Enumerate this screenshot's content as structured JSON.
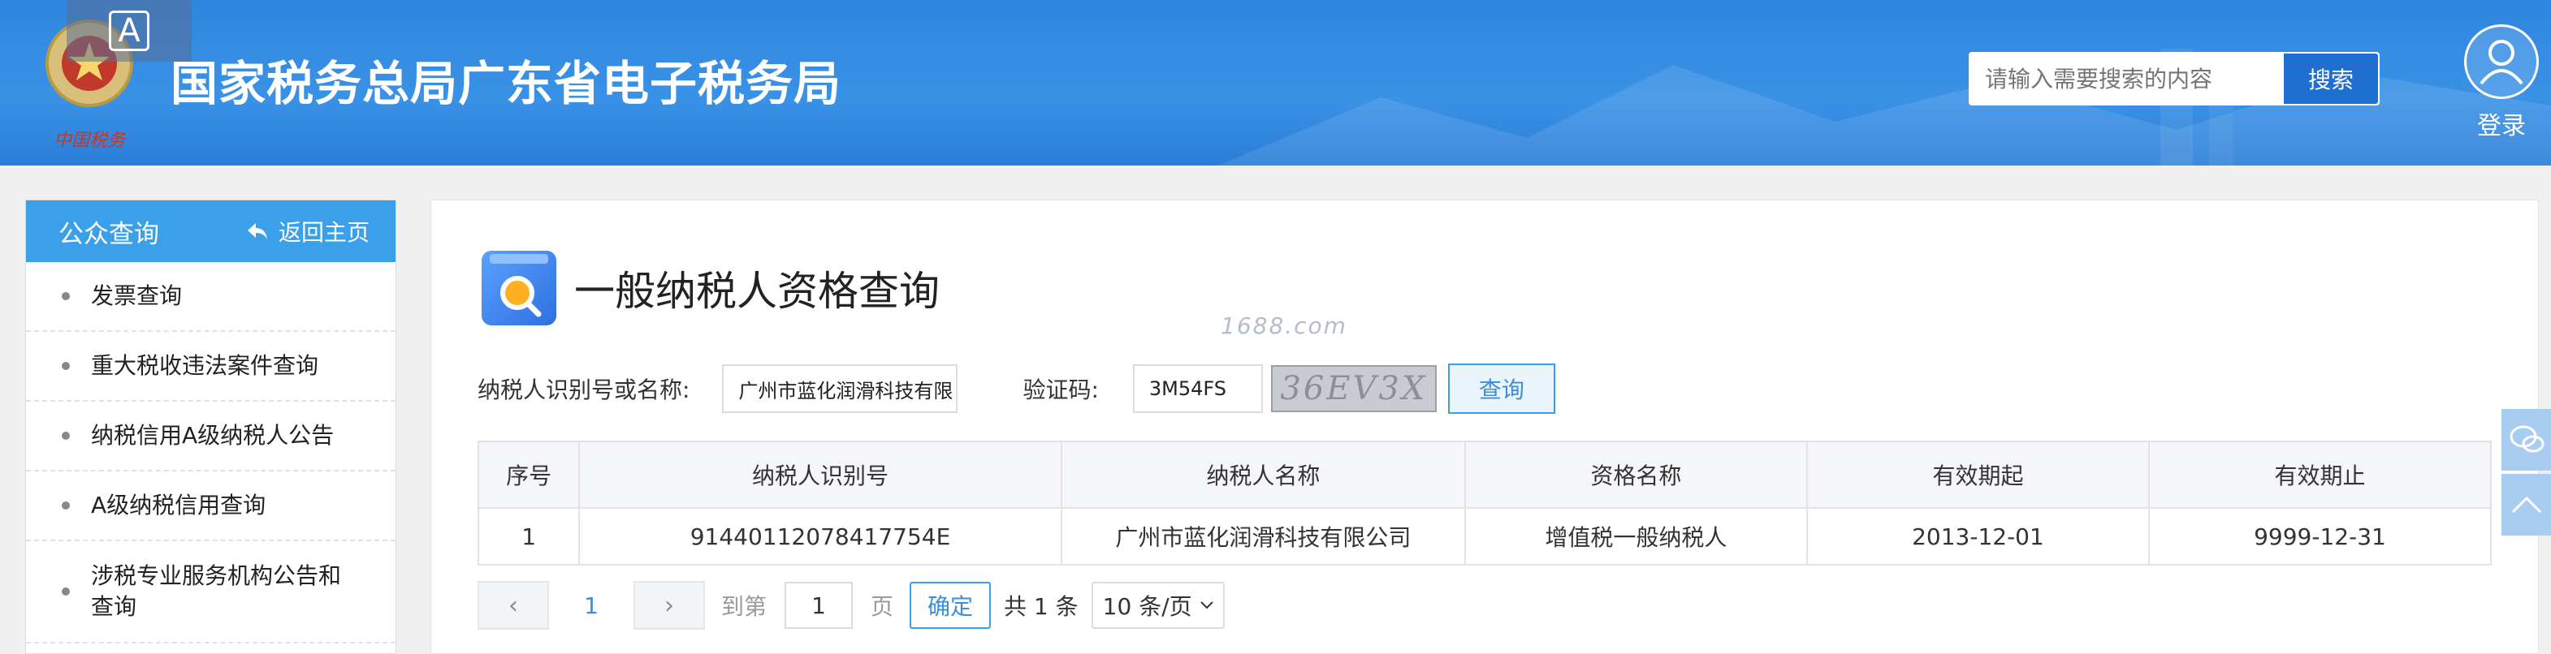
{
  "header": {
    "site_title": "国家税务总局广东省电子税务局",
    "emblem_caption": "中国税务",
    "search_placeholder": "请输入需要搜索的内容",
    "search_button": "搜索",
    "login_label": "登录",
    "accessibility_icon": "A"
  },
  "sidebar": {
    "title": "公众查询",
    "back_label": "返回主页",
    "items": [
      {
        "label": "发票查询"
      },
      {
        "label": "重大税收违法案件查询"
      },
      {
        "label": "纳税信用A级纳税人公告"
      },
      {
        "label": "A级纳税信用查询"
      },
      {
        "label": "涉税专业服务机构公告和查询"
      }
    ]
  },
  "main": {
    "page_title": "一般纳税人资格查询",
    "watermark": "1688.com",
    "form": {
      "taxpayer_label": "纳税人识别号或名称:",
      "taxpayer_value": "广州市蓝化润滑科技有限",
      "captcha_label": "验证码:",
      "captcha_value": "3M54FS",
      "captcha_image_text": "36EV3X",
      "query_button": "查询"
    },
    "table": {
      "headers": [
        "序号",
        "纳税人识别号",
        "纳税人名称",
        "资格名称",
        "有效期起",
        "有效期止"
      ],
      "rows": [
        [
          "1",
          "91440112078417754E",
          "广州市蓝化润滑科技有限公司",
          "增值税一般纳税人",
          "2013-12-01",
          "9999-12-31"
        ]
      ]
    },
    "pagination": {
      "prev_icon": "‹",
      "current_page": "1",
      "next_icon": "›",
      "goto_label": "到第",
      "goto_value": "1",
      "page_unit": "页",
      "confirm": "确定",
      "total": "共 1 条",
      "page_size": "10 条/页"
    }
  },
  "colors": {
    "header_bg": "#2f86e0",
    "sidebar_head": "#3aa0ea",
    "accent": "#3a8fd8"
  }
}
